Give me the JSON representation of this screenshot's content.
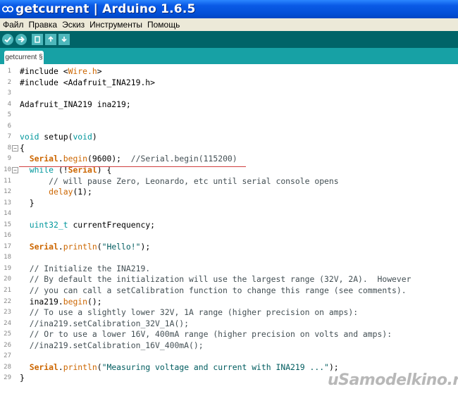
{
  "window": {
    "title": "getcurrent | Arduino 1.6.5"
  },
  "menu": [
    "Файл",
    "Правка",
    "Эскиз",
    "Инструменты",
    "Помощь"
  ],
  "toolbar": [
    "verify-icon",
    "upload-icon",
    "new-icon",
    "open-icon",
    "save-icon"
  ],
  "tab": {
    "label": "getcurrent §"
  },
  "editor": {
    "lines": [
      {
        "n": "1",
        "t": "#include <Wire.h>"
      },
      {
        "n": "2",
        "t": "#include <Adafruit_INA219.h>"
      },
      {
        "n": "3",
        "t": ""
      },
      {
        "n": "4",
        "t": "Adafruit_INA219 ina219;"
      },
      {
        "n": "5",
        "t": ""
      },
      {
        "n": "6",
        "t": ""
      },
      {
        "n": "7",
        "t": "void setup(void)"
      },
      {
        "n": "8",
        "t": "{"
      },
      {
        "n": "9",
        "t": "  Serial.begin(9600);  //Serial.begin(115200)"
      },
      {
        "n": "10",
        "t": "  while (!Serial) {"
      },
      {
        "n": "11",
        "t": "      // will pause Zero, Leonardo, etc until serial console opens"
      },
      {
        "n": "12",
        "t": "      delay(1);"
      },
      {
        "n": "13",
        "t": "  }"
      },
      {
        "n": "14",
        "t": ""
      },
      {
        "n": "15",
        "t": "  uint32_t currentFrequency;"
      },
      {
        "n": "16",
        "t": ""
      },
      {
        "n": "17",
        "t": "  Serial.println(\"Hello!\");"
      },
      {
        "n": "18",
        "t": ""
      },
      {
        "n": "19",
        "t": "  // Initialize the INA219."
      },
      {
        "n": "20",
        "t": "  // By default the initialization will use the largest range (32V, 2A).  However"
      },
      {
        "n": "21",
        "t": "  // you can call a setCalibration function to change this range (see comments)."
      },
      {
        "n": "22",
        "t": "  ina219.begin();"
      },
      {
        "n": "23",
        "t": "  // To use a slightly lower 32V, 1A range (higher precision on amps):"
      },
      {
        "n": "24",
        "t": "  //ina219.setCalibration_32V_1A();"
      },
      {
        "n": "25",
        "t": "  // Or to use a lower 16V, 400mA range (higher precision on volts and amps):"
      },
      {
        "n": "26",
        "t": "  //ina219.setCalibration_16V_400mA();"
      },
      {
        "n": "27",
        "t": ""
      },
      {
        "n": "28",
        "t": "  Serial.println(\"Measuring voltage and current with INA219 ...\");"
      },
      {
        "n": "29",
        "t": "}"
      }
    ]
  },
  "watermark": "uSamodelkino.ru",
  "colors": {
    "title_bar": "#0451d9",
    "toolbar": "#006468",
    "tabrow": "#17a1a5",
    "keyword": "#cc6600",
    "type": "#00979c",
    "string": "#005c5f"
  }
}
